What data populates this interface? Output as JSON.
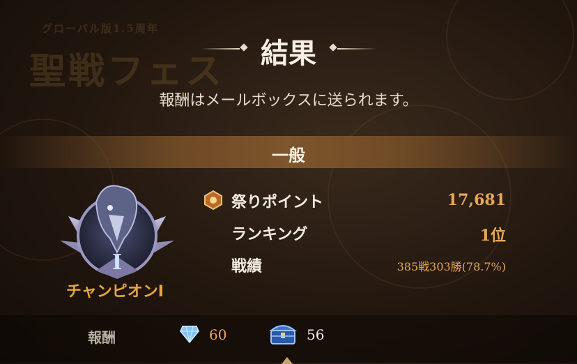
{
  "background": {
    "event_logo_small": "グローバル版1.5周年",
    "event_logo_big": "聖戦フェス"
  },
  "header": {
    "title": "結果",
    "subtitle": "報酬はメールボックスに送られます。"
  },
  "section": {
    "label": "一般"
  },
  "rank": {
    "emblem_icon": "champion-crow-emblem-icon",
    "numeral": "I",
    "name": "チャンピオンⅠ"
  },
  "stats": [
    {
      "label": "祭りポイント",
      "value": "17,681",
      "icon": "festival-point-icon"
    },
    {
      "label": "ランキング",
      "value": "1位"
    },
    {
      "label": "戦績",
      "value": "385戦303勝(78.7%)"
    }
  ],
  "rewards": {
    "label": "報酬",
    "items": [
      {
        "icon": "diamond-gem-icon",
        "count": "60"
      },
      {
        "icon": "treasure-chest-icon",
        "count": "56"
      }
    ]
  },
  "colors": {
    "accent_gold": "#e8a85a",
    "rank_orange": "#e8a63c",
    "text_light": "#f2ebe0"
  }
}
